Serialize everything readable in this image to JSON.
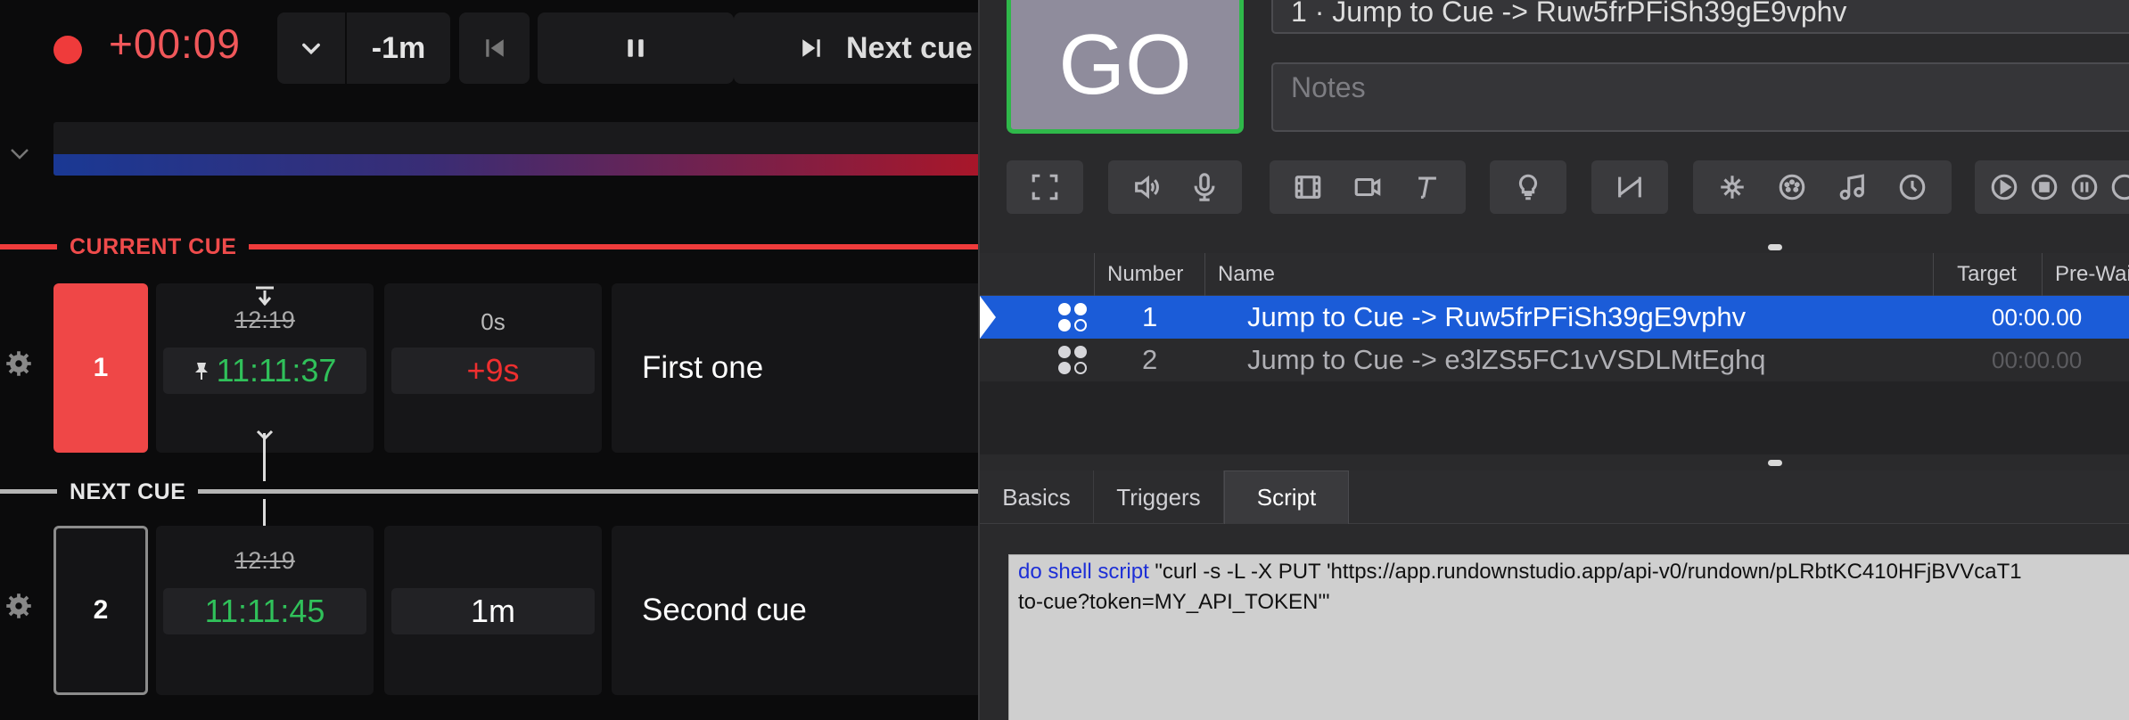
{
  "rundown": {
    "timer": "+00:09",
    "toolbar": {
      "minus_label": "-1m",
      "next_label": "Next cue"
    },
    "sections": {
      "current": "CURRENT CUE",
      "next": "NEXT CUE"
    },
    "cues": [
      {
        "number": "1",
        "scheduled": "12:19",
        "start_time": "11:11:37",
        "duration_top": "0s",
        "duration_value": "+9s",
        "title": "First one"
      },
      {
        "number": "2",
        "scheduled": "12:19",
        "start_time": "11:11:45",
        "duration_value": "1m",
        "title": "Second cue"
      }
    ],
    "colors": {
      "accent_red": "#ef3b3b",
      "green": "#30c15a"
    }
  },
  "qlab": {
    "go_label": "GO",
    "cue_title": "1 · Jump to Cue -> Ruw5frPFiSh39gE9vphv",
    "notes_placeholder": "Notes",
    "columns": [
      "Number",
      "Name",
      "Target",
      "Pre-Wait"
    ],
    "rows": [
      {
        "number": "1",
        "name": "Jump to Cue -> Ruw5frPFiSh39gE9vphv",
        "target": "",
        "pre_wait": "00:00.00",
        "selected": true
      },
      {
        "number": "2",
        "name": "Jump to Cue -> e3lZS5FC1vVSDLMtEghq",
        "target": "",
        "pre_wait": "00:00.00",
        "selected": false
      }
    ],
    "tabs": [
      "Basics",
      "Triggers",
      "Script"
    ],
    "active_tab": "Script",
    "script": {
      "keyword": "do shell script",
      "line1": " \"curl -s -L -X PUT 'https://app.rundownstudio.app/api-v0/rundown/pLRbtKC410HFjBVVcaT1",
      "line2": "to-cue?token=MY_API_TOKEN'\""
    },
    "colors": {
      "selection": "#1b5cd8",
      "go_border": "#2fb84a"
    }
  }
}
